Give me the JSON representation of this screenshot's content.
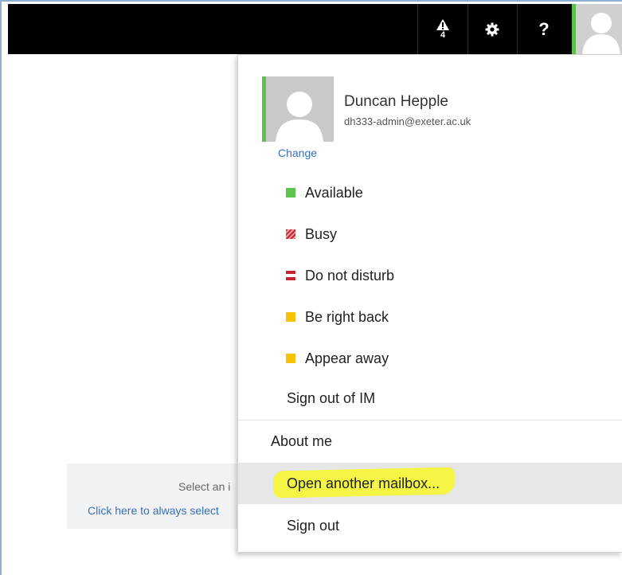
{
  "topbar": {
    "alert_icon": "warning-icon",
    "alert_count": "4",
    "settings_icon": "gear-icon",
    "help_label": "?",
    "avatar_icon": "user-avatar-icon",
    "presence_color": "#5dc24b"
  },
  "background": {
    "select_text": "Select an i",
    "always_select_link": "Click here to always select"
  },
  "profile": {
    "name": "Duncan Hepple",
    "email": "dh333-admin@exeter.ac.uk",
    "change_label": "Change"
  },
  "status_items": [
    {
      "label": "Available",
      "color": "#5cc54c",
      "icon": "available-status-icon"
    },
    {
      "label": "Busy",
      "color": "#c7262f",
      "icon": "busy-status-icon"
    },
    {
      "label": "Do not disturb",
      "color": "#c7262f",
      "icon": "do-not-disturb-status-icon"
    },
    {
      "label": "Be right back",
      "color": "#f4c308",
      "icon": "be-right-back-status-icon"
    },
    {
      "label": "Appear away",
      "color": "#f4c308",
      "icon": "appear-away-status-icon"
    }
  ],
  "menu": {
    "sign_out_im": "Sign out of IM",
    "about_me": "About me",
    "open_mailbox": "Open another mailbox...",
    "sign_out": "Sign out",
    "highlight_color": "#f4f53c"
  }
}
